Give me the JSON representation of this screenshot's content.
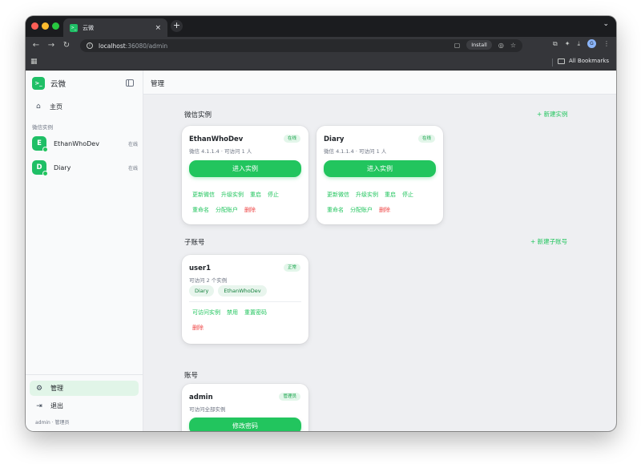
{
  "browser": {
    "tab_title": "云微",
    "tab_favicon": ">_",
    "tab_close": "×",
    "new_tab": "+",
    "url_host": "localhost",
    "url_path": ":36080/admin",
    "install_label": "Install",
    "bookmarks_label": "All Bookmarks"
  },
  "sidebar": {
    "brand_name": "云微",
    "brand_logo": ">_",
    "home_label": "主页",
    "section_label": "微信实例",
    "instances": [
      {
        "initial": "E",
        "name": "EthanWhoDev",
        "status": "在线"
      },
      {
        "initial": "D",
        "name": "Diary",
        "status": "在线"
      }
    ],
    "admin_label": "管理",
    "logout_label": "退出",
    "user_meta": "admin · 管理员"
  },
  "main": {
    "title": "管理",
    "instances_section": {
      "title": "微信实例",
      "action": "+ 新建实例",
      "cards": [
        {
          "name": "EthanWhoDev",
          "badge": "在线",
          "meta": "微信 4.1.1.4 · 可访问 1 人",
          "button": "进入实例",
          "links_row1": [
            "更新微信",
            "升级实例",
            "重启",
            "停止"
          ],
          "links_row2": [
            "重命名",
            "分配账户"
          ],
          "danger": "删除"
        },
        {
          "name": "Diary",
          "badge": "在线",
          "meta": "微信 4.1.1.4 · 可访问 1 人",
          "button": "进入实例",
          "links_row1": [
            "更新微信",
            "升级实例",
            "重启",
            "停止"
          ],
          "links_row2": [
            "重命名",
            "分配账户"
          ],
          "danger": "删除"
        }
      ]
    },
    "subaccounts_section": {
      "title": "子账号",
      "action": "+ 新建子账号",
      "card": {
        "name": "user1",
        "badge": "正常",
        "meta": "可访问 2 个实例",
        "tags": [
          "Diary",
          "EthanWhoDev"
        ],
        "links": [
          "可访问实例",
          "禁用",
          "重置密码"
        ],
        "danger": "删除"
      }
    },
    "account_section": {
      "title": "账号",
      "card": {
        "name": "admin",
        "badge": "管理员",
        "meta": "可访问全部实例",
        "button": "修改密码"
      }
    }
  },
  "colors": {
    "accent": "#22c55e",
    "danger": "#ef4444",
    "sidebar_active": "#e1f5e8"
  }
}
